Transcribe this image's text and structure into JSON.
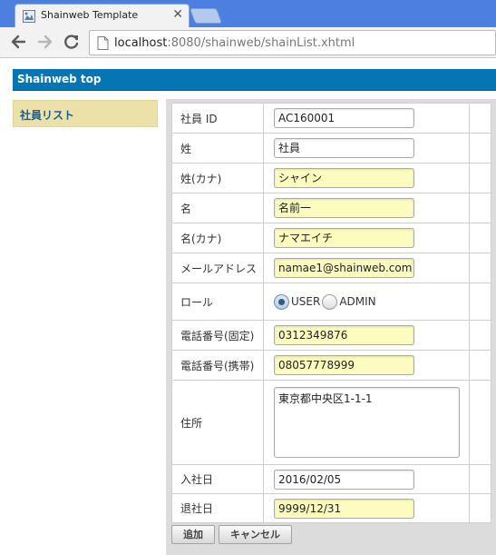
{
  "browser": {
    "tab_title": "Shainweb Template",
    "tab_close": "✕",
    "url_host": "localhost",
    "url_path": ":8080/shainweb/shainList.xhtml"
  },
  "header": {
    "title": "Shainweb top"
  },
  "sidebar": {
    "items": [
      {
        "label": "社員リスト"
      }
    ]
  },
  "form": {
    "shain_id": {
      "label": "社員 ID",
      "value": "AC160001"
    },
    "sei": {
      "label": "姓",
      "value": "社員"
    },
    "sei_kana": {
      "label": "姓(カナ)",
      "value": "シャイン"
    },
    "mei": {
      "label": "名",
      "value": "名前一"
    },
    "mei_kana": {
      "label": "名(カナ)",
      "value": "ナマエイチ"
    },
    "email": {
      "label": "メールアドレス",
      "value": "namae1@shainweb.com"
    },
    "role": {
      "label": "ロール",
      "options": [
        "USER",
        "ADMIN"
      ],
      "selected": "USER"
    },
    "tel_fixed": {
      "label": "電話番号(固定)",
      "value": "0312349876"
    },
    "tel_mobile": {
      "label": "電話番号(携帯)",
      "value": "08057778999"
    },
    "address": {
      "label": "住所",
      "value": "東京都中央区1-1-1"
    },
    "join_date": {
      "label": "入社日",
      "value": "2016/02/05"
    },
    "leave_date": {
      "label": "退社日",
      "value": "9999/12/31"
    }
  },
  "actions": {
    "add_label": "追加",
    "cancel_label": "キャンセル"
  },
  "colors": {
    "header_bg": "#0675b3",
    "sidebar_bg": "#ebe1a9",
    "required_bg": "#fbfcbe"
  }
}
